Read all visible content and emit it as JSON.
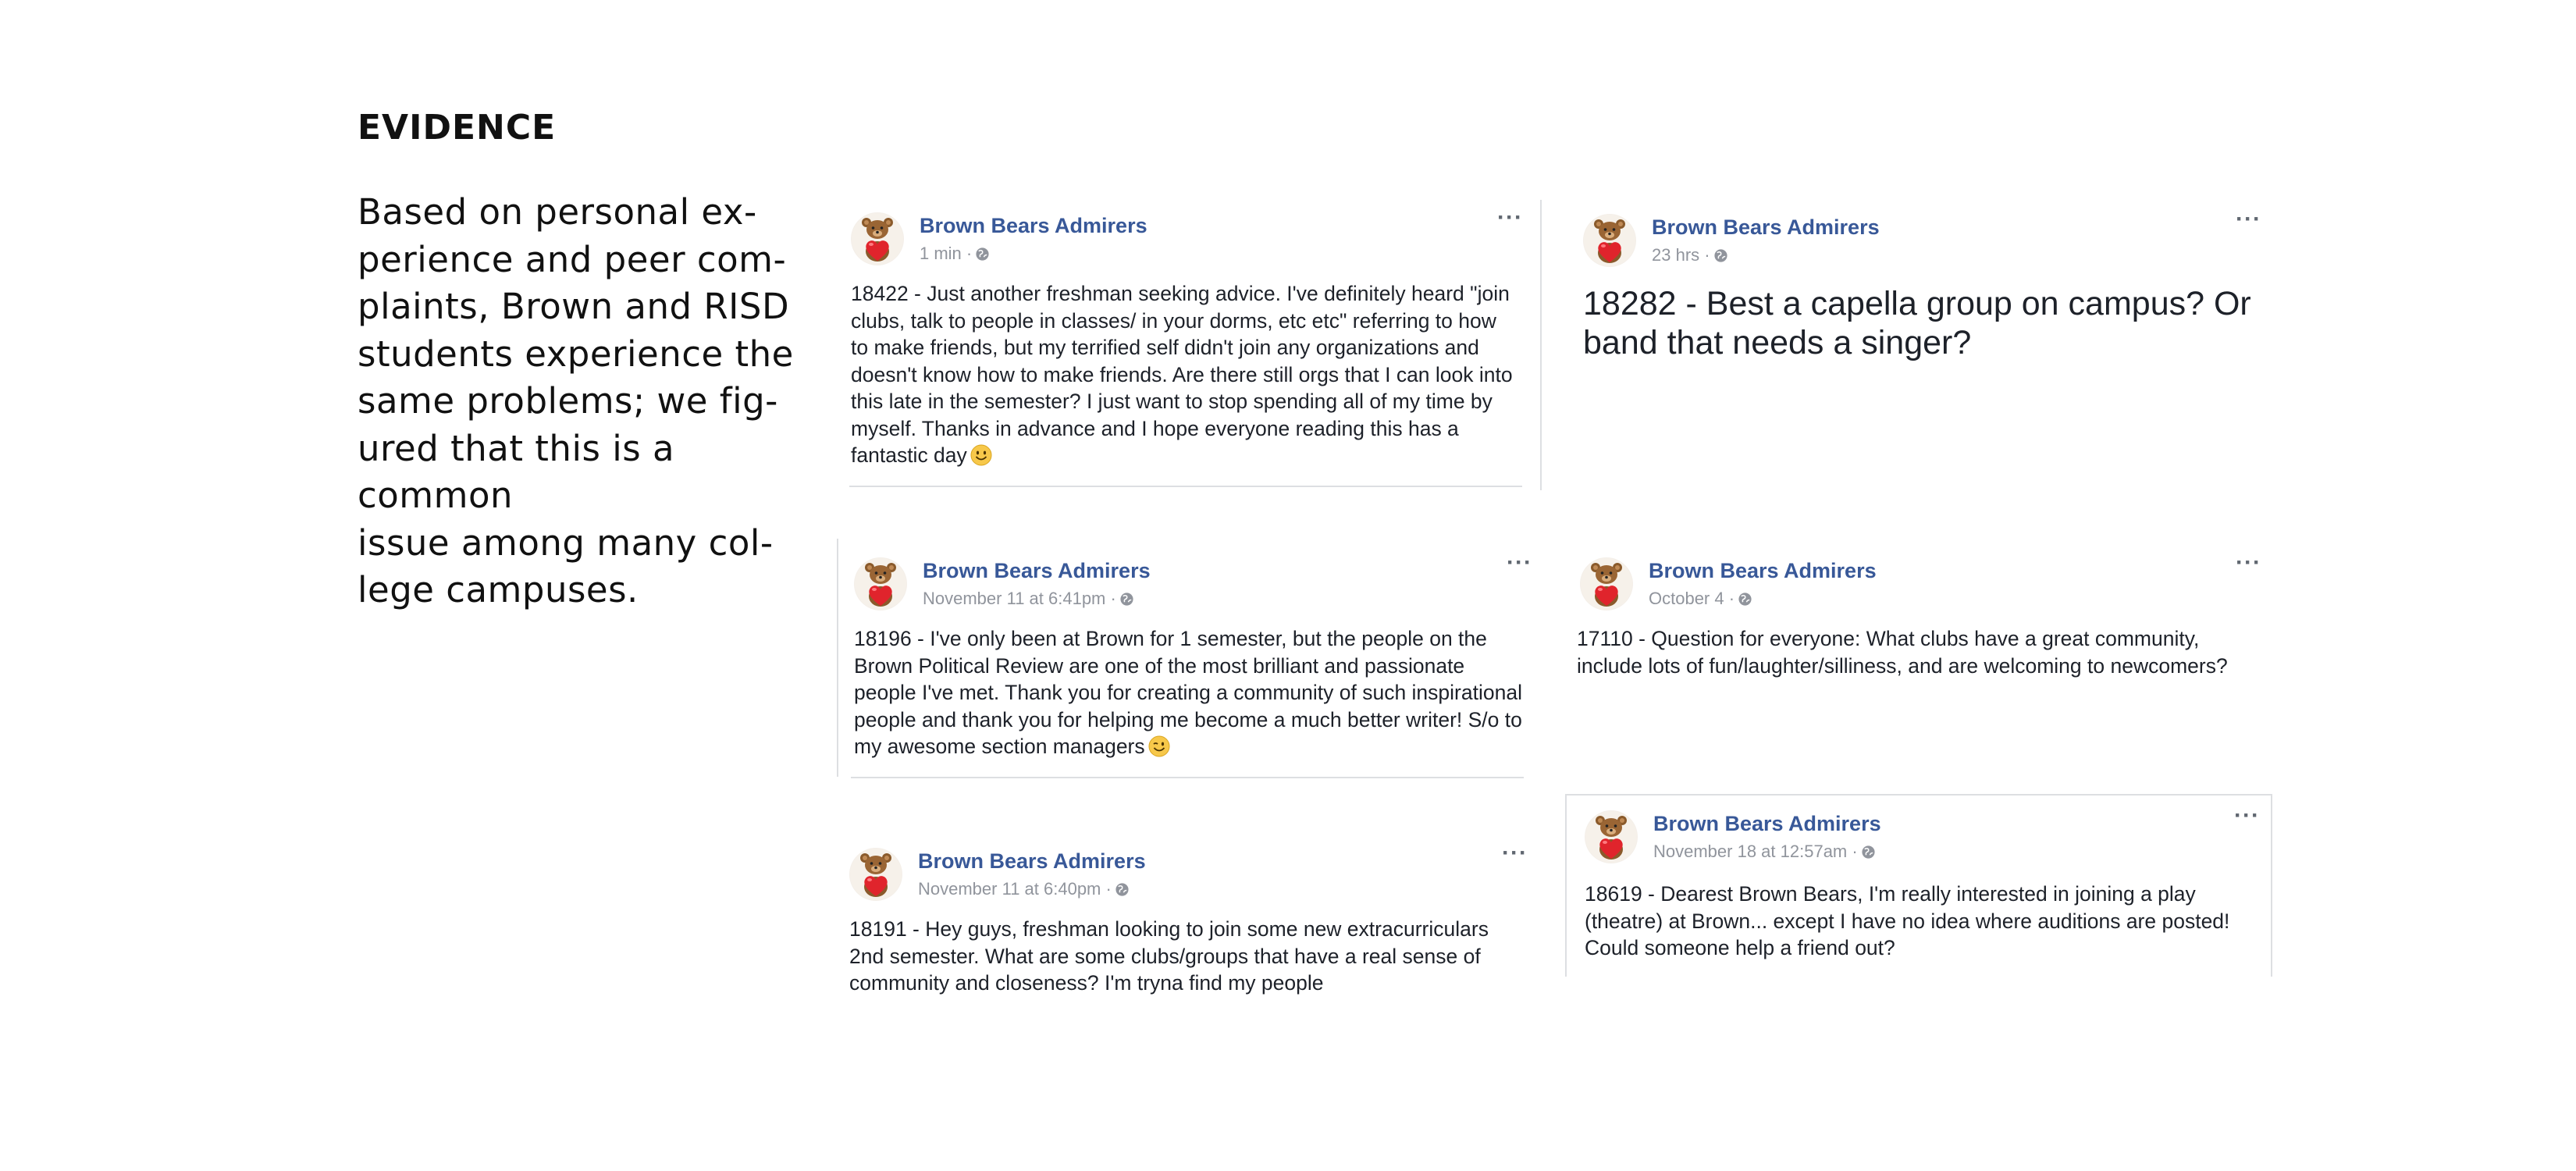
{
  "heading": "EVIDENCE",
  "intro_lines": [
    "Based on personal ex-",
    "perience and peer com-",
    "plaints, Brown and RISD",
    "students experience the",
    "same problems; we fig-",
    "ured that this is a common",
    "issue among many col-",
    "lege campuses."
  ],
  "posts": [
    {
      "page": "Brown Bears Admirers",
      "time": "1 min ·",
      "lines": [
        "18422 - Just another freshman seeking advice. I've definitely heard \"join",
        "clubs, talk to people in classes/ in your dorms, etc etc\" referring to how",
        "to make friends, but my terrified self didn't join any organizations and",
        "doesn't know how to make friends. Are there still orgs that I can look into",
        "this late in the semester? I just want to stop spending all of my time by",
        "myself. Thanks in advance and I hope everyone reading this has a",
        "fantastic day"
      ],
      "emoji": "smile-emoji"
    },
    {
      "page": "Brown Bears Admirers",
      "time": "23 hrs ·",
      "lines": [
        "18282 - Best a capella group on campus? Or",
        "band that needs a singer?"
      ]
    },
    {
      "page": "Brown Bears Admirers",
      "time": "November 11 at 6:41pm ·",
      "lines": [
        "18196 - I've only been at Brown for 1 semester, but the people on the",
        "Brown Political Review are one of the most brilliant and passionate",
        "people I've met. Thank you for creating a community of such inspirational",
        "people and thank you for helping me become a much better writer! S/o to",
        "my awesome section managers"
      ],
      "emoji": "wink-emoji"
    },
    {
      "page": "Brown Bears Admirers",
      "time": "October 4 ·",
      "lines": [
        "17110 - Question for everyone: What clubs have a great community,",
        "include lots of fun/laughter/silliness, and are welcoming to newcomers?"
      ]
    },
    {
      "page": "Brown Bears Admirers",
      "time": "November 11 at 6:40pm ·",
      "lines": [
        "18191 - Hey guys, freshman looking to join some new extracurriculars",
        "2nd semester. What are some clubs/groups that have a real sense of",
        "community and closeness? I'm tryna find my people"
      ]
    },
    {
      "page": "Brown Bears Admirers",
      "time": "November 18 at 12:57am ·",
      "lines": [
        "18619 - Dearest Brown Bears, I'm really interested in joining a play",
        "(theatre) at Brown... except I have no idea where auditions are posted!",
        "Could someone help a friend out?"
      ]
    }
  ],
  "more_label": "···",
  "colors": {
    "link": "#385898",
    "meta": "#90949c",
    "divider": "#dddfe2"
  }
}
